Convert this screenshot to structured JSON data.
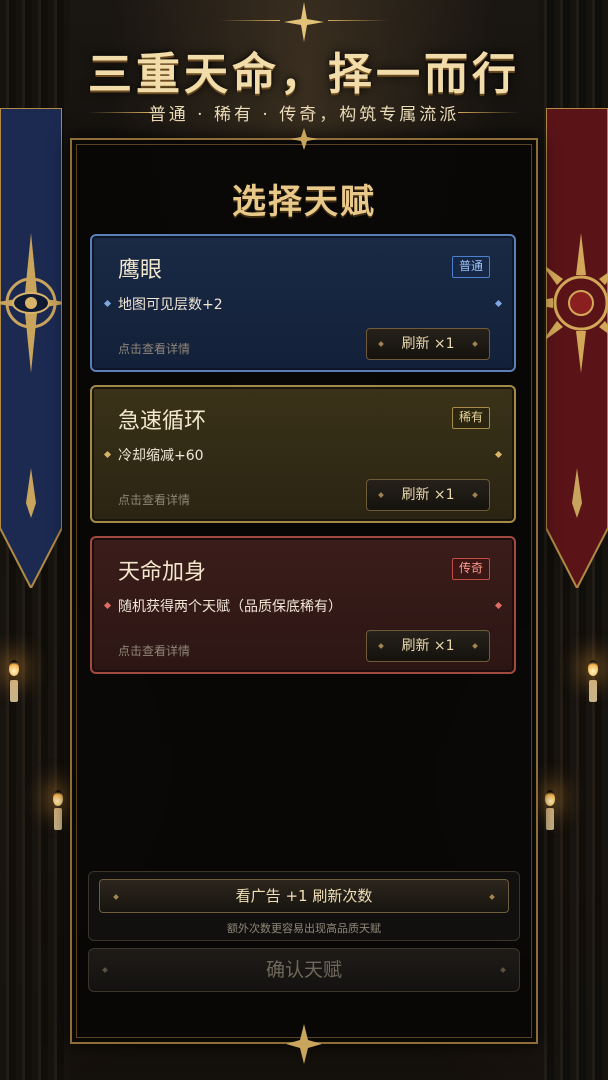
{
  "header": {
    "title": "三重天命，择一而行",
    "subtitle": "普通 · 稀有 · 传奇，构筑专属流派"
  },
  "panel": {
    "title": "选择天赋"
  },
  "cards": [
    {
      "name": "鹰眼",
      "rarity": "普通",
      "effect": "地图可见层数+2",
      "detail": "点击查看详情",
      "refresh_label": "刷新 ×1"
    },
    {
      "name": "急速循环",
      "rarity": "稀有",
      "effect": "冷却缩减+60",
      "detail": "点击查看详情",
      "refresh_label": "刷新 ×1"
    },
    {
      "name": "天命加身",
      "rarity": "传奇",
      "effect": "随机获得两个天赋（品质保底稀有）",
      "detail": "点击查看详情",
      "refresh_label": "刷新 ×1"
    }
  ],
  "ad": {
    "button_label": "看广告 +1 刷新次数",
    "note": "额外次数更容易出现高品质天赋"
  },
  "confirm": {
    "label": "确认天赋"
  },
  "colors": {
    "common": "#5a7fb8",
    "rare": "#a38a48",
    "legend": "#a14a40",
    "gold": "#e9c98a"
  },
  "icons": {
    "left_banner": "eye-compass-icon",
    "right_banner": "sun-icon",
    "crown_ornament": "star-ornament-icon"
  }
}
